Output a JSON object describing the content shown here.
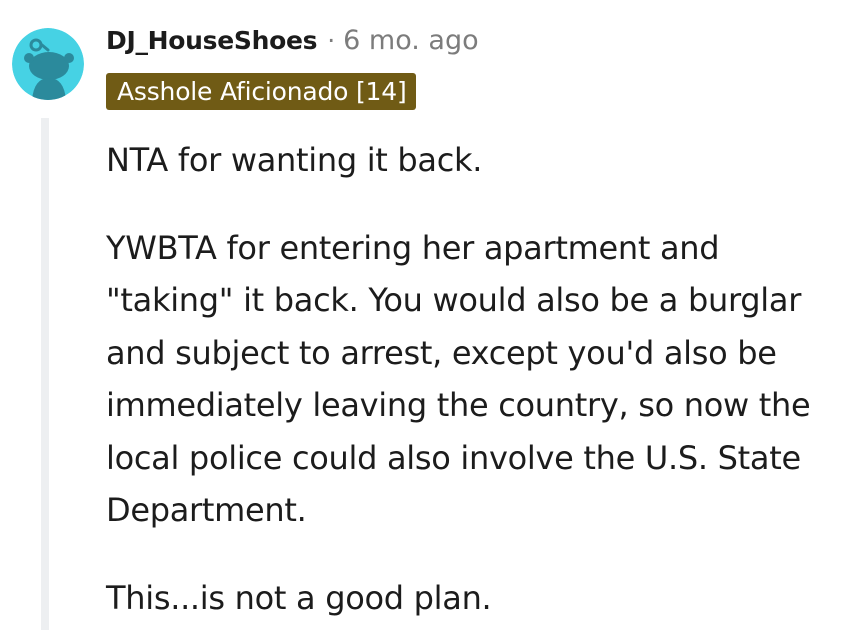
{
  "comment": {
    "username": "DJ_HouseShoes",
    "separator": "·",
    "timestamp": "6 mo. ago",
    "flair": "Asshole Aficionado [14]",
    "paragraphs": [
      "NTA for wanting it back.",
      "YWBTA for entering her apartment and \"taking\" it back. You would also be a burglar and subject to arrest, except you'd also be immediately leaving the country, so now the local police could also involve the U.S. State Department.",
      "This...is not a good plan."
    ]
  },
  "colors": {
    "avatar_background": "#46d2e4",
    "avatar_figure": "#2b8a9c",
    "flair_background": "#705b15",
    "flair_text": "#ffffff",
    "meta_text": "#7c7c7c",
    "body_text": "#1c1c1c",
    "thread_line": "#edeff1"
  },
  "icons": {
    "avatar": "reddit-snoo-avatar-icon"
  }
}
